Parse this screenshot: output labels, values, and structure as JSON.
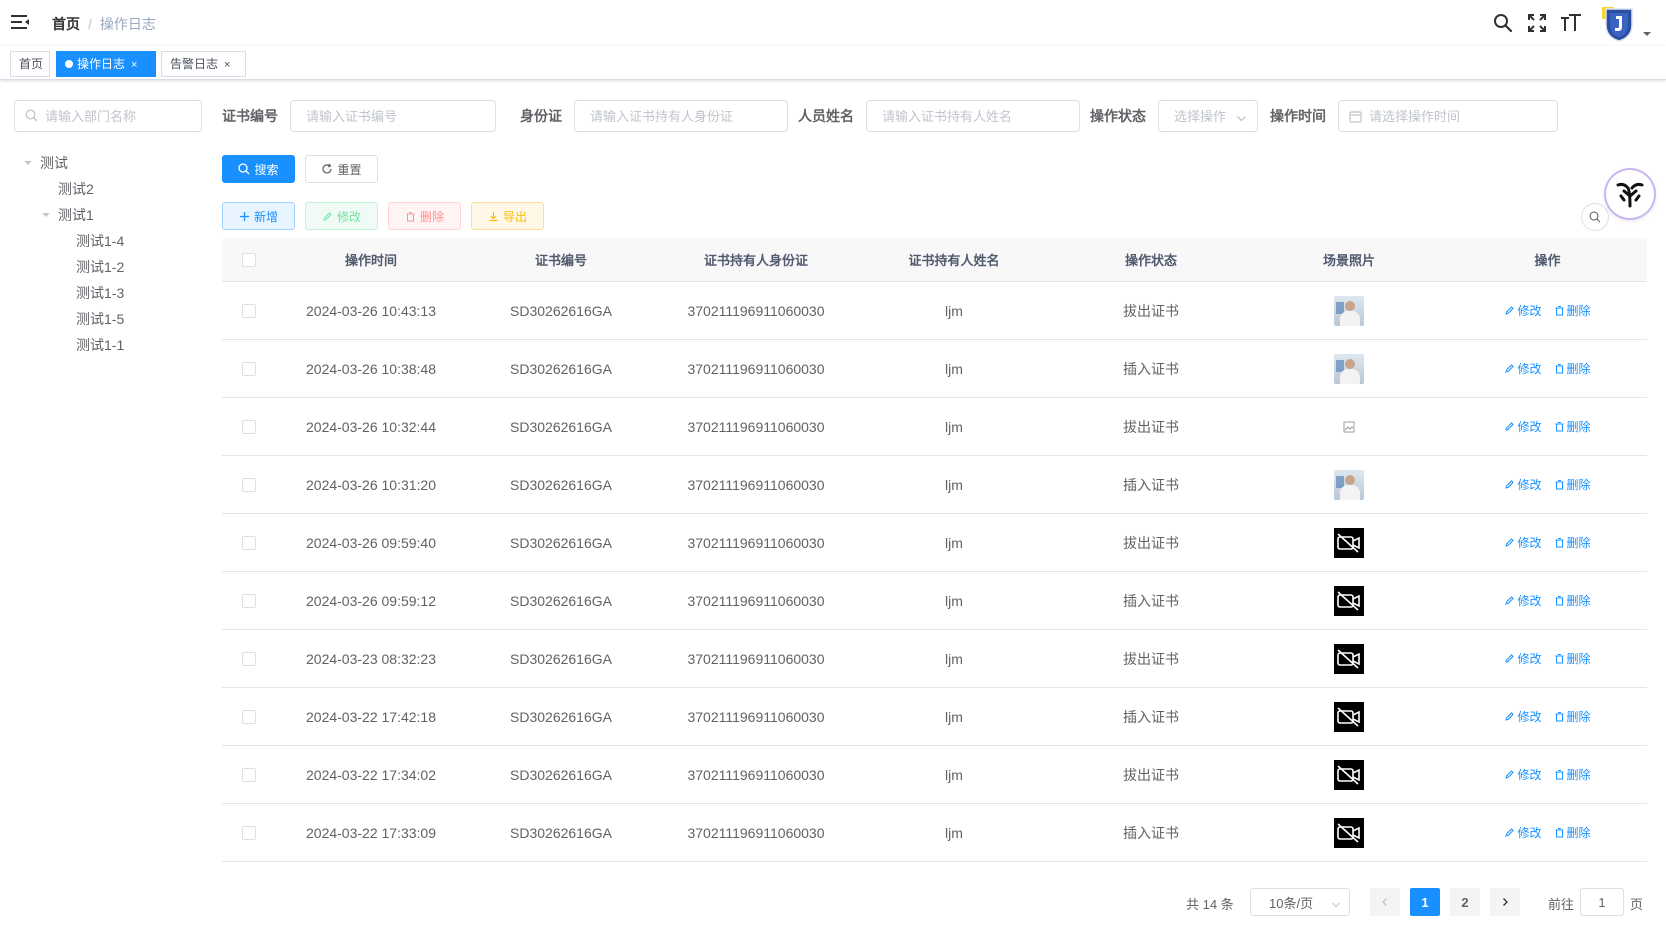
{
  "navbar": {
    "breadcrumb_home": "首页",
    "breadcrumb_separator": "/",
    "breadcrumb_current": "操作日志"
  },
  "tags": [
    {
      "label": "首页",
      "active": false
    },
    {
      "label": "操作日志",
      "active": true,
      "close": "×"
    },
    {
      "label": "告警日志",
      "active": false,
      "close": "×"
    }
  ],
  "dept": {
    "search_placeholder": "请输入部门名称",
    "tree": [
      {
        "label": "测试",
        "level": 0,
        "expanded": true
      },
      {
        "label": "测试2",
        "level": 1
      },
      {
        "label": "测试1",
        "level": 1,
        "expanded": true
      },
      {
        "label": "测试1-4",
        "level": 2
      },
      {
        "label": "测试1-2",
        "level": 2
      },
      {
        "label": "测试1-3",
        "level": 2
      },
      {
        "label": "测试1-5",
        "level": 2
      },
      {
        "label": "测试1-1",
        "level": 2
      }
    ]
  },
  "form": {
    "cert_label": "证书编号",
    "cert_placeholder": "请输入证书编号",
    "id_label": "身份证",
    "id_placeholder": "请输入证书持有人身份证",
    "name_label": "人员姓名",
    "name_placeholder": "请输入证书持有人姓名",
    "status_label": "操作状态",
    "status_placeholder": "选择操作",
    "time_label": "操作时间",
    "time_placeholder": "请选择操作时间"
  },
  "buttons": {
    "search": "搜索",
    "reset": "重置",
    "add": "新增",
    "edit": "修改",
    "delete": "删除",
    "export": "导出"
  },
  "table": {
    "headers": [
      "操作时间",
      "证书编号",
      "证书持有人身份证",
      "证书持有人姓名",
      "操作状态",
      "场景照片",
      "操作"
    ],
    "edit_label": "修改",
    "delete_label": "删除",
    "rows": [
      {
        "time": "2024-03-26 10:43:13",
        "cert": "SD30262616GA",
        "id": "370211196911060030",
        "name": "ljm",
        "status": "拔出证书",
        "photo": "image"
      },
      {
        "time": "2024-03-26 10:38:48",
        "cert": "SD30262616GA",
        "id": "370211196911060030",
        "name": "ljm",
        "status": "插入证书",
        "photo": "image"
      },
      {
        "time": "2024-03-26 10:32:44",
        "cert": "SD30262616GA",
        "id": "370211196911060030",
        "name": "ljm",
        "status": "拔出证书",
        "photo": "broken"
      },
      {
        "time": "2024-03-26 10:31:20",
        "cert": "SD30262616GA",
        "id": "370211196911060030",
        "name": "ljm",
        "status": "插入证书",
        "photo": "image"
      },
      {
        "time": "2024-03-26 09:59:40",
        "cert": "SD30262616GA",
        "id": "370211196911060030",
        "name": "ljm",
        "status": "拔出证书",
        "photo": "no-video"
      },
      {
        "time": "2024-03-26 09:59:12",
        "cert": "SD30262616GA",
        "id": "370211196911060030",
        "name": "ljm",
        "status": "插入证书",
        "photo": "no-video"
      },
      {
        "time": "2024-03-23 08:32:23",
        "cert": "SD30262616GA",
        "id": "370211196911060030",
        "name": "ljm",
        "status": "拔出证书",
        "photo": "no-video"
      },
      {
        "time": "2024-03-22 17:42:18",
        "cert": "SD30262616GA",
        "id": "370211196911060030",
        "name": "ljm",
        "status": "插入证书",
        "photo": "no-video"
      },
      {
        "time": "2024-03-22 17:34:02",
        "cert": "SD30262616GA",
        "id": "370211196911060030",
        "name": "ljm",
        "status": "拔出证书",
        "photo": "no-video"
      },
      {
        "time": "2024-03-22 17:33:09",
        "cert": "SD30262616GA",
        "id": "370211196911060030",
        "name": "ljm",
        "status": "插入证书",
        "photo": "no-video"
      }
    ]
  },
  "pagination": {
    "total": "共 14 条",
    "page_size": "10条/页",
    "pages": [
      "1",
      "2"
    ],
    "current": "1",
    "goto_label": "前往",
    "goto_value": "1",
    "page_suffix": "页"
  },
  "colors": {
    "primary": "#1890ff",
    "success": "#13ce66",
    "danger": "#ff4949",
    "warning": "#ffba00"
  }
}
